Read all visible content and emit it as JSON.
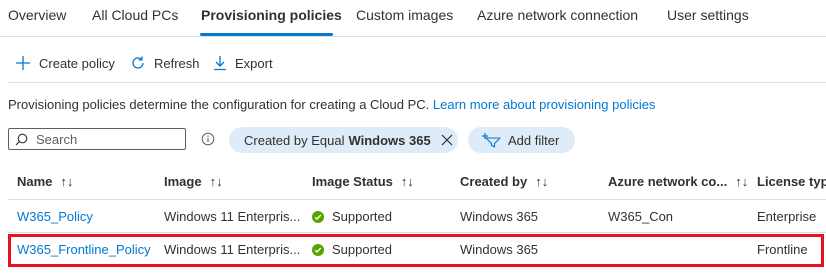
{
  "tabs": [
    {
      "label": "Overview",
      "active": false
    },
    {
      "label": "All Cloud PCs",
      "active": false
    },
    {
      "label": "Provisioning policies",
      "active": true
    },
    {
      "label": "Custom images",
      "active": false
    },
    {
      "label": "Azure network connection",
      "active": false
    },
    {
      "label": "User settings",
      "active": false
    }
  ],
  "toolbar": {
    "create_label": "Create policy",
    "refresh_label": "Refresh",
    "export_label": "Export"
  },
  "description": {
    "text": "Provisioning policies determine the configuration for creating a Cloud PC.",
    "link_text": "Learn more about provisioning policies"
  },
  "search": {
    "placeholder": "Search",
    "value": ""
  },
  "filter": {
    "prefix": "Created by Equal",
    "value": "Windows 365",
    "add_filter_label": "Add filter"
  },
  "table": {
    "columns": [
      "Name",
      "Image",
      "Image Status",
      "Created by",
      "Azure network co...",
      "License type"
    ],
    "sort_glyph": "↑↓",
    "rows": [
      {
        "name": "W365_Policy",
        "image": "Windows 11 Enterpris...",
        "status": "Supported",
        "created_by": "Windows 365",
        "network": "W365_Con",
        "license": "Enterprise"
      },
      {
        "name": "W365_Frontline_Policy",
        "image": "Windows 11 Enterpris...",
        "status": "Supported",
        "created_by": "Windows 365",
        "network": "",
        "license": "Frontline"
      }
    ]
  },
  "colors": {
    "accent": "#0078d4",
    "highlight": "#e81123",
    "success": "#57a300",
    "pill": "#deecf9"
  }
}
